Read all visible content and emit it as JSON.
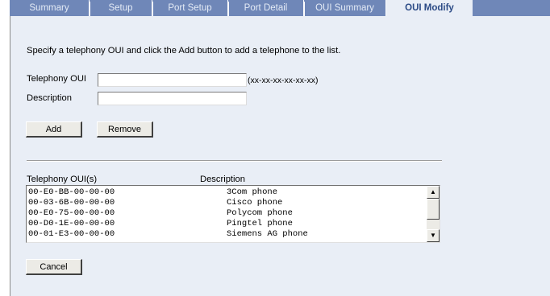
{
  "tabs": [
    {
      "label": "Summary"
    },
    {
      "label": "Setup"
    },
    {
      "label": "Port Setup"
    },
    {
      "label": "Port Detail"
    },
    {
      "label": "OUI Summary"
    },
    {
      "label": "OUI Modify"
    }
  ],
  "instructions": "Specify a telephony OUI and click the Add button to add a telephone to the list.",
  "form": {
    "oui_label": "Telephony OUI",
    "oui_value": "",
    "oui_hint": "(xx-xx-xx-xx-xx-xx)",
    "desc_label": "Description",
    "desc_value": ""
  },
  "buttons": {
    "add": "Add",
    "remove": "Remove",
    "cancel": "Cancel"
  },
  "list": {
    "col1_header": "Telephony OUI(s)",
    "col2_header": "Description",
    "rows": [
      {
        "oui": "00-E0-BB-00-00-00",
        "desc": "3Com phone"
      },
      {
        "oui": "00-03-6B-00-00-00",
        "desc": "Cisco phone"
      },
      {
        "oui": "00-E0-75-00-00-00",
        "desc": "Polycom phone"
      },
      {
        "oui": "00-D0-1E-00-00-00",
        "desc": "Pingtel phone"
      },
      {
        "oui": "00-01-E3-00-00-00",
        "desc": "Siemens AG phone"
      }
    ]
  },
  "colors": {
    "tab_bg": "#6f87b8",
    "active_tab_bg": "#e9eef6",
    "panel_bg": "#e9eef6"
  }
}
